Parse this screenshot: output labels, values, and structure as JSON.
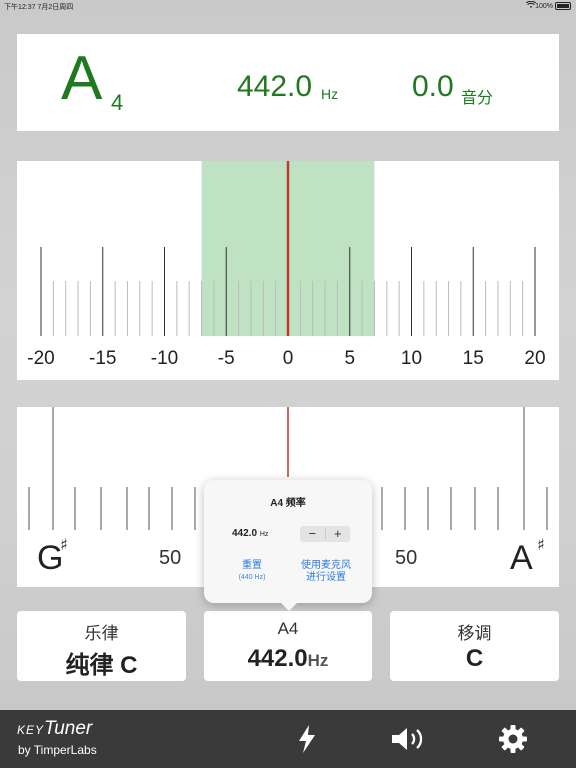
{
  "status_bar": {
    "time": "下午12:37",
    "date": "7月2日周四",
    "battery": "100%"
  },
  "readout": {
    "note": "A",
    "octave": "4",
    "frequency": "442.0",
    "frequency_unit": "Hz",
    "cents": "0.0",
    "cents_unit": "音分"
  },
  "meter": {
    "ticks": [
      "-20",
      "-15",
      "-10",
      "-5",
      "0",
      "5",
      "10",
      "15",
      "20"
    ],
    "in_tune_range": [
      -7,
      7
    ],
    "needle": 0,
    "colors": {
      "zone": "#bfe3c2",
      "needle": "#c0392b"
    }
  },
  "strobe": {
    "left_note": "G",
    "left_accidental": "♯",
    "left_cents": "50",
    "right_cents": "50",
    "right_note": "A",
    "right_accidental": "♯"
  },
  "popup": {
    "title": "A4 频率",
    "frequency": "442.0",
    "frequency_unit": "Hz",
    "minus": "−",
    "plus": "+",
    "reset_label": "重置",
    "reset_sub": "(440 Hz)",
    "mic_line1": "使用麦克风",
    "mic_line2": "进行设置"
  },
  "bottom": {
    "temperament": {
      "label": "乐律",
      "value": "纯律 C"
    },
    "reference": {
      "label": "A4",
      "value": "442.0",
      "unit": "Hz"
    },
    "transpose": {
      "label": "移调",
      "value": "C"
    }
  },
  "footer": {
    "brand_key": "KEY",
    "brand_tuner": "Tuner",
    "brand_by": "by TimperLabs",
    "icons": [
      "lightning-icon",
      "speaker-icon",
      "gear-icon"
    ]
  }
}
